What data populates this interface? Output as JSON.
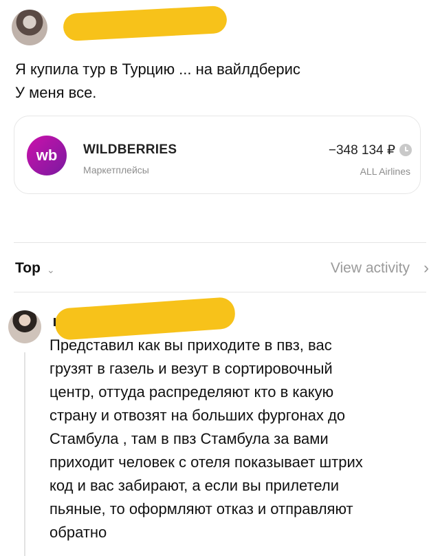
{
  "post": {
    "lines": [
      "Я купила тур в Турцию ... на вайлдберис",
      "У меня все."
    ]
  },
  "transaction": {
    "logo_text": "wb",
    "merchant": "WILDBERRIES",
    "category": "Маркетплейсы",
    "amount": "−348 134 ₽",
    "merchant_sub": "ALL Airlines",
    "status_icon": "clock-icon"
  },
  "replies_bar": {
    "sort_label": "Top",
    "view_activity_label": "View activity"
  },
  "reply": {
    "lines": [
      "Представил как вы приходите в пвз, вас",
      "грузят в газель и везут в сортировочный",
      "центр, оттуда распределяют кто в какую",
      "страну и отвозят на больших фургонах до",
      "Стамбула , там в пвз Стамбула за вами",
      "приходит человек с отеля показывает штрих",
      "код и вас забирают, а если вы прилетели",
      "пьяные, то оформляют отказ и отправляют",
      "обратно"
    ]
  },
  "colors": {
    "redaction": "#f7c21a",
    "wb_brand": "#cb11ab",
    "muted_text": "#8d8d8d"
  }
}
